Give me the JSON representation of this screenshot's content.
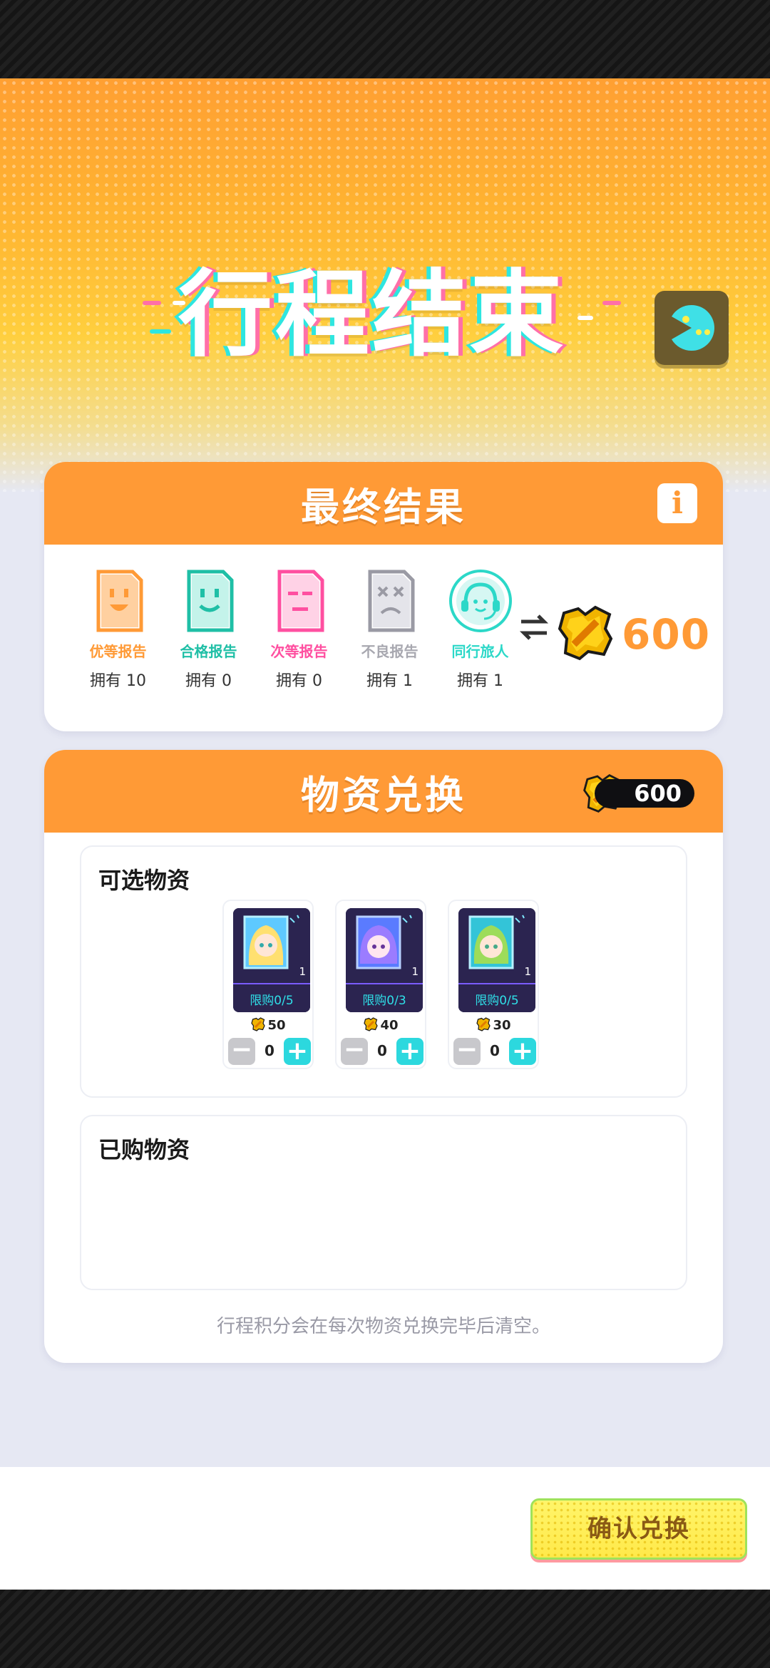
{
  "header": {
    "title": "行程结束",
    "menu_icon": "pacman-icon"
  },
  "result": {
    "title": "最终结果",
    "info_icon": "info-icon",
    "reports": [
      {
        "label": "优等报告",
        "owned": "拥有 10",
        "color": "#ff9a36",
        "icon": "happy-report-icon"
      },
      {
        "label": "合格报告",
        "owned": "拥有 0",
        "color": "#1fbfa6",
        "icon": "smile-report-icon"
      },
      {
        "label": "次等报告",
        "owned": "拥有 0",
        "color": "#ff4fa0",
        "icon": "meh-report-icon"
      },
      {
        "label": "不良报告",
        "owned": "拥有 1",
        "color": "#a8a8b0",
        "icon": "bad-report-icon"
      },
      {
        "label": "同行旅人",
        "owned": "拥有 1",
        "color": "#2cd8c8",
        "icon": "headset-companion-icon"
      }
    ],
    "total_points": "600",
    "points_icon": "travel-points-icon"
  },
  "exchange": {
    "title": "物资兑换",
    "balance": "600",
    "available_title": "可选物资",
    "items": [
      {
        "limit": "限购0/5",
        "qty_tag": "1",
        "price": "50",
        "quantity": "0",
        "art": "blonde-character-icon"
      },
      {
        "limit": "限购0/3",
        "qty_tag": "1",
        "price": "40",
        "quantity": "0",
        "art": "purple-character-icon"
      },
      {
        "limit": "限购0/5",
        "qty_tag": "1",
        "price": "30",
        "quantity": "0",
        "art": "green-character-icon"
      }
    ],
    "purchased_title": "已购物资",
    "note": "行程积分会在每次物资兑换完毕后清空。"
  },
  "footer": {
    "confirm_label": "确认兑换"
  },
  "colors": {
    "accent_orange": "#ff9a36",
    "teal": "#2cd8de",
    "page_bg": "#e6e8f3"
  }
}
